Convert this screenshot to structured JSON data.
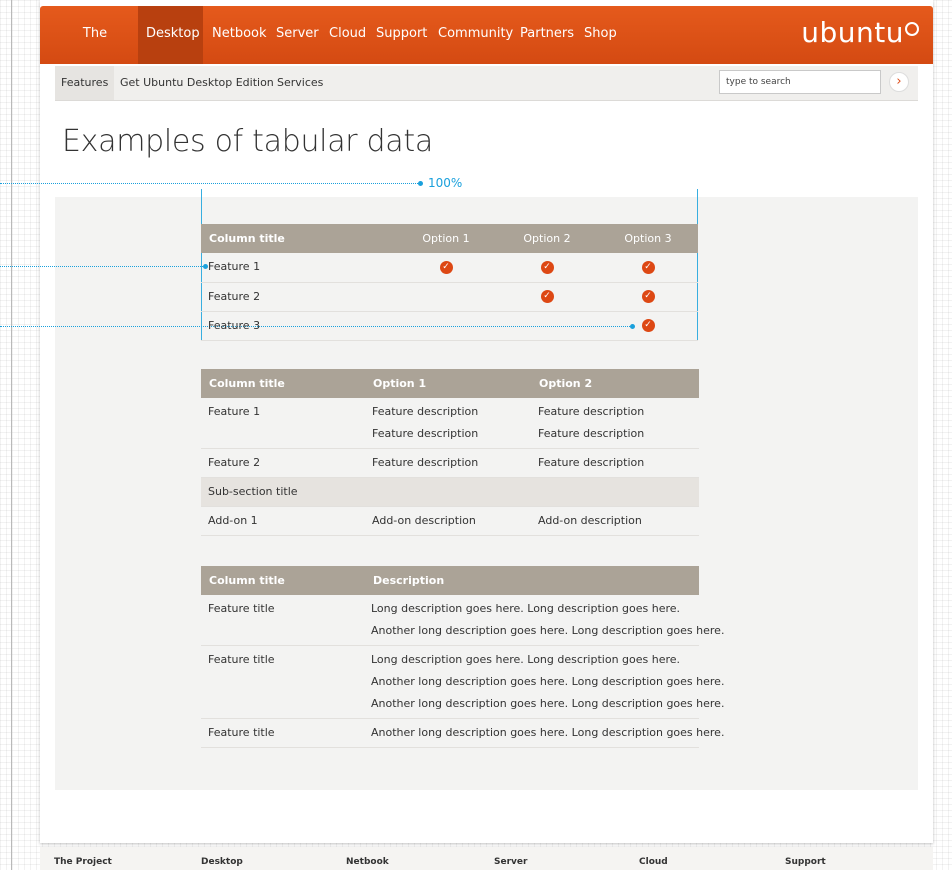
{
  "nav": {
    "items": [
      "The project",
      "Desktop",
      "Netbook",
      "Server",
      "Cloud",
      "Support",
      "Community",
      "Partners",
      "Shop"
    ],
    "active_index": 1,
    "logo": "ubuntu"
  },
  "subnav": {
    "items": [
      "Features",
      "Get Ubuntu Desktop Edition",
      "Services"
    ],
    "active_index": 0
  },
  "search": {
    "placeholder": "type to search",
    "button_icon": "chevron-right-icon"
  },
  "page_title": "Examples of tabular data",
  "annotation": {
    "width_label": "100%"
  },
  "table1": {
    "headers": [
      "Column title",
      "Option 1",
      "Option 2",
      "Option 3"
    ],
    "rows": [
      {
        "feature": "Feature 1",
        "checks": [
          true,
          true,
          true
        ]
      },
      {
        "feature": "Feature 2",
        "checks": [
          false,
          true,
          true
        ]
      },
      {
        "feature": "Feature 3",
        "checks": [
          false,
          false,
          true
        ]
      }
    ]
  },
  "table2": {
    "headers": [
      "Column title",
      "Option 1",
      "Option 2"
    ],
    "rows": [
      {
        "feature": "Feature 1",
        "opt1": [
          "Feature description",
          "Feature description"
        ],
        "opt2": [
          "Feature description",
          "Feature description"
        ]
      },
      {
        "feature": "Feature 2",
        "opt1": [
          "Feature description"
        ],
        "opt2": [
          "Feature description"
        ]
      }
    ],
    "subsection": "Sub-section title",
    "addon": {
      "feature": "Add-on 1",
      "opt1": "Add-on description",
      "opt2": "Add-on description"
    }
  },
  "table3": {
    "headers": [
      "Column title",
      "Description"
    ],
    "rows": [
      {
        "title": "Feature title",
        "lines": [
          "Long description goes here. Long description goes here.",
          "Another long description goes here. Long description goes here."
        ]
      },
      {
        "title": "Feature title",
        "lines": [
          "Long description goes here. Long description goes here.",
          "Another long description goes here. Long description goes here.",
          "Another long description goes here. Long description goes here."
        ]
      },
      {
        "title": "Feature title",
        "lines": [
          "Another long description goes here. Long description goes here."
        ]
      }
    ]
  },
  "footer": {
    "items": [
      "The Project",
      "Desktop",
      "Netbook",
      "Server",
      "Cloud",
      "Support"
    ]
  },
  "colors": {
    "brand": "#dd4814",
    "header_bg": "#aba397",
    "annotation": "#1aa0dc"
  }
}
